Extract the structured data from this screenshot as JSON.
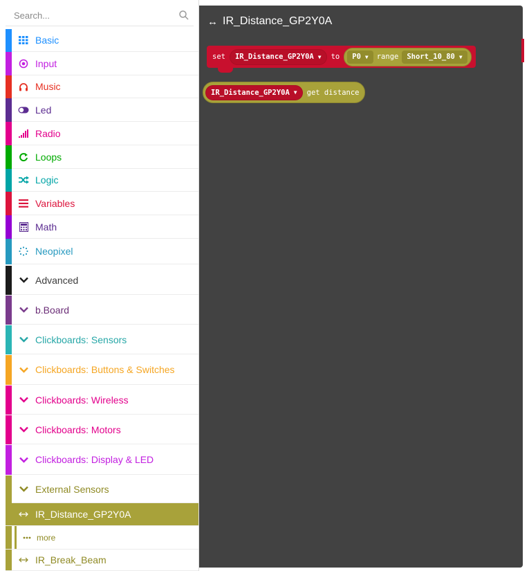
{
  "search": {
    "placeholder": "Search..."
  },
  "categories": [
    {
      "label": "Basic",
      "icon": "grid-icon",
      "color": "#1e90ff"
    },
    {
      "label": "Input",
      "icon": "target-icon",
      "color": "#c21fe0"
    },
    {
      "label": "Music",
      "icon": "headphones-icon",
      "color": "#e63022"
    },
    {
      "label": "Led",
      "icon": "toggle-icon",
      "color": "#5c2d91"
    },
    {
      "label": "Radio",
      "icon": "signal-bars-icon",
      "color": "#e3008c"
    },
    {
      "label": "Loops",
      "icon": "loop-arrow-icon",
      "color": "#00aa00"
    },
    {
      "label": "Logic",
      "icon": "shuffle-icon",
      "color": "#00a4a6"
    },
    {
      "label": "Variables",
      "icon": "list-lines-icon",
      "color": "#dc143c"
    },
    {
      "label": "Math",
      "icon": "calculator-icon",
      "color": "#9400d3"
    },
    {
      "label": "Neopixel",
      "icon": "dotted-circle-icon",
      "color": "#2699bf"
    }
  ],
  "advanced": [
    {
      "label": "Advanced",
      "color": "#3c3c3c",
      "bar": "#1b1b1b"
    },
    {
      "label": "b.Board",
      "color": "#6b2e77",
      "bar": "#7a3b8c"
    },
    {
      "label": "Clickboards: Sensors",
      "color": "#26a7a7",
      "bar": "#2bb5b5"
    },
    {
      "label": "Clickboards: Buttons & Switches",
      "color": "#f5a623",
      "bar": "#f5a623"
    },
    {
      "label": "Clickboards: Wireless",
      "color": "#e3008c",
      "bar": "#e3008c"
    },
    {
      "label": "Clickboards: Motors",
      "color": "#e3008c",
      "bar": "#e3008c"
    },
    {
      "label": "Clickboards: Display & LED",
      "color": "#c21fe0",
      "bar": "#c21fe0"
    },
    {
      "label": "External Sensors",
      "color": "#8f8a24",
      "bar": "#a8a23a"
    }
  ],
  "subcategories": [
    {
      "label": "IR_Distance_GP2Y0A",
      "icon": "double-arrow-icon",
      "selected": true
    },
    {
      "label": "more",
      "icon": "ellipsis-icon",
      "selected": false
    },
    {
      "label": "IR_Break_Beam",
      "icon": "double-arrow-icon",
      "selected": false
    }
  ],
  "workspace": {
    "title": "IR_Distance_GP2Y0A",
    "set_block": {
      "set_label": "set",
      "variable": "IR_Distance_GP2Y0A",
      "to_label": "to",
      "pin": "P0",
      "range_label": "range",
      "range_value": "Short_10_80"
    },
    "get_block": {
      "variable": "IR_Distance_GP2Y0A",
      "action": "get distance"
    }
  },
  "colors": {
    "workspace_bg": "#424242",
    "block_red": "#c8102e",
    "block_olive": "#a8a23a"
  }
}
